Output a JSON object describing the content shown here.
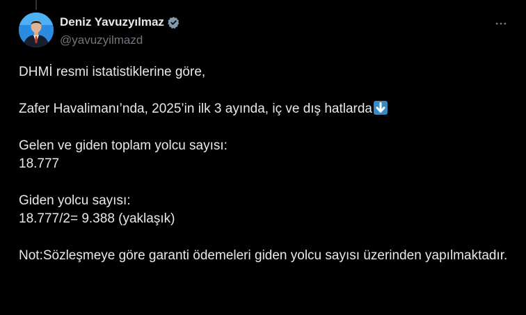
{
  "author": {
    "display_name": "Deniz Yavuzyılmaz",
    "handle": "@yavuzyilmazd",
    "verified_icon": "verified-badge",
    "avatar_icon": "profile-photo"
  },
  "menu": {
    "more_icon": "more-horizontal"
  },
  "tweet": {
    "line_1": "DHMİ resmi istatistiklerine göre,",
    "line_2": "Zafer Havalimanı’nda, 2025’in ilk 3 ayında, iç ve dış hatlarda",
    "line_2_emoji": "down-arrow-emoji",
    "line_3a": "Gelen ve giden toplam yolcu sayısı:",
    "line_3b": "18.777",
    "line_4a": "Giden yolcu sayısı:",
    "line_4b": "18.777/2= 9.388 (yaklaşık)",
    "line_5": "Not:Sözleşmeye göre garanti ödemeleri giden yolcu sayısı üzerinden yapılmaktadır."
  },
  "colors": {
    "background": "#000000",
    "text_primary": "#e7e9ea",
    "text_secondary": "#71767b",
    "accent": "#1d9bf0"
  }
}
